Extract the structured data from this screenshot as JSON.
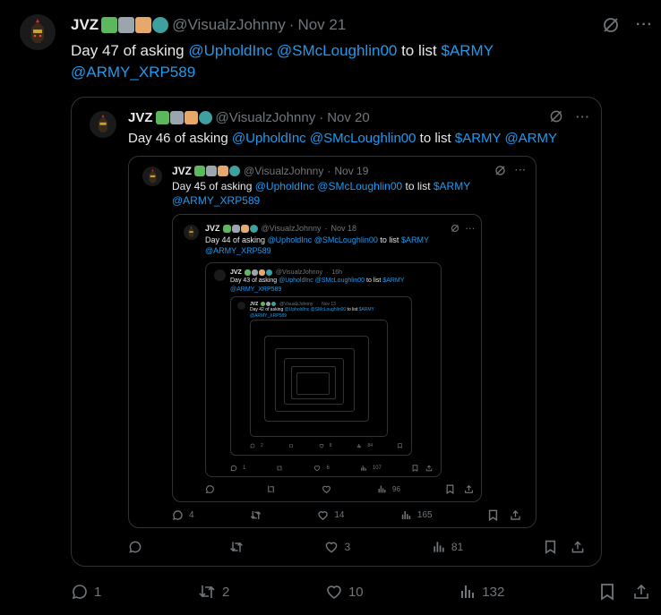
{
  "tweets": [
    {
      "name": "JVZ",
      "handle": "@VisualzJohnny",
      "date": "Nov 21",
      "text_prefix": "Day 47 of asking ",
      "mention1": "@UpholdInc",
      "mention2": "@SMcLoughlin00",
      "text_mid": " to list ",
      "mention3": "$ARMY",
      "mention4": "@ARMY_XRP589",
      "replies": "1",
      "reposts": "2",
      "likes": "10",
      "views": "132"
    },
    {
      "name": "JVZ",
      "handle": "@VisualzJohnny",
      "date": "Nov 20",
      "text_prefix": "Day 46 of asking ",
      "mention1": "@UpholdInc",
      "mention2": "@SMcLoughlin00",
      "text_mid": " to list ",
      "mention3": "$ARMY",
      "mention4": "@ARMY",
      "replies": "",
      "reposts": "",
      "likes": "3",
      "views": "81"
    },
    {
      "name": "JVZ",
      "handle": "@VisualzJohnny",
      "date": "Nov 19",
      "text_prefix": "Day 45 of asking ",
      "mention1": "@UpholdInc",
      "mention2": "@SMcLoughlin00",
      "text_mid": " to list ",
      "mention3": "$ARMY",
      "mention4": "@ARMY_XRP589",
      "replies": "4",
      "reposts": "",
      "likes": "14",
      "views": "165"
    },
    {
      "name": "JVZ",
      "handle": "@VisualzJohnny",
      "date": "Nov 18",
      "text_prefix": "Day 44 of asking ",
      "mention1": "@UpholdInc",
      "mention2": "@SMcLoughlin00",
      "text_mid": " to list ",
      "mention3": "$ARMY",
      "mention4": "@ARMY_XRP589",
      "replies": "",
      "reposts": "",
      "likes": "",
      "views": "96"
    },
    {
      "name": "JVZ",
      "handle": "@VisualzJohnny",
      "date": "16h",
      "text_prefix": "Day 43 of asking ",
      "mention1": "@UpholdInc",
      "mention2": "@SMcLoughlin00",
      "text_mid": " to list ",
      "mention3": "$ARMY",
      "mention4": "@ARMY_XRP589",
      "replies": "1",
      "reposts": "",
      "likes": "6",
      "views": "107"
    },
    {
      "name": "JVZ",
      "handle": "@VisualzJohnny",
      "date": "Nov 13",
      "text_prefix": "Day 42 of asking ",
      "mention1": "@UpholdInc",
      "mention2": "@SMcLoughlin00",
      "text_mid": " to list ",
      "mention3": "$ARMY",
      "mention4": "@ARMY_XRP589",
      "replies": "2",
      "reposts": "",
      "likes": "8",
      "views": "84"
    }
  ],
  "colors": {
    "accent": "#1d9bf0",
    "muted": "#71767b",
    "border": "#2f3336",
    "text": "#e7e9ea",
    "background": "#000000"
  },
  "icons": [
    "grok-icon",
    "more-icon",
    "reply-icon",
    "repost-icon",
    "like-icon",
    "views-icon",
    "bookmark-icon",
    "share-icon"
  ]
}
